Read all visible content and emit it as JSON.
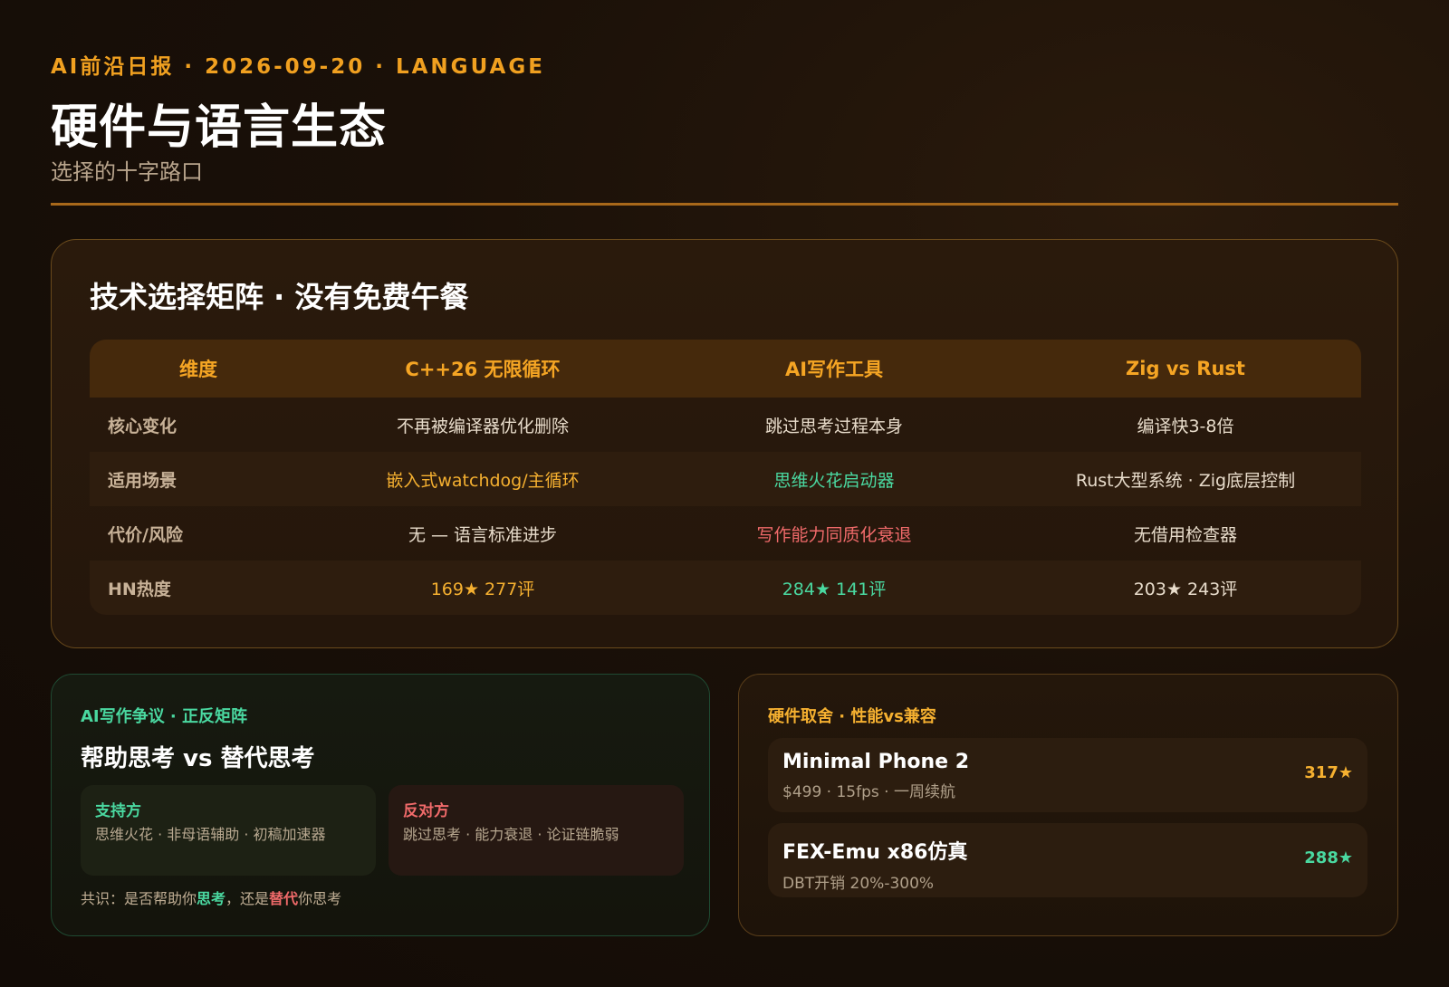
{
  "header": {
    "kicker": "AI前沿日报 · 2026-09-20 · LANGUAGE",
    "title": "硬件与语言生态",
    "subtitle": "选择的十字路口"
  },
  "matrix": {
    "title": "技术选择矩阵 · 没有免费午餐",
    "columns": [
      "维度",
      "C++26 无限循环",
      "AI写作工具",
      "Zig vs Rust"
    ],
    "rows": [
      {
        "label": "核心变化",
        "cells": [
          "不再被编译器优化删除",
          "跳过思考过程本身",
          "编译快3-8倍"
        ]
      },
      {
        "label": "适用场景",
        "cells": [
          "嵌入式watchdog/主循环",
          "思维火花启动器",
          "Rust大型系统 · Zig底层控制"
        ]
      },
      {
        "label": "代价/风险",
        "cells": [
          "无 — 语言标准进步",
          "写作能力同质化衰退",
          "无借用检查器"
        ]
      },
      {
        "label": "HN热度",
        "cells": [
          "169★ 277评",
          "284★ 141评",
          "203★ 243评"
        ]
      }
    ],
    "colors": {
      "amber": "#f5b030",
      "green": "#4ad8a0",
      "red": "#f06a6a"
    }
  },
  "ai_debate": {
    "kicker": "AI写作争议 · 正反矩阵",
    "heading": "帮助思考 vs 替代思考",
    "pro": {
      "label": "支持方",
      "text": "思维火花 · 非母语辅助 · 初稿加速器"
    },
    "con": {
      "label": "反对方",
      "text": "跳过思考 · 能力衰退 · 论证链脆弱"
    },
    "consensus": {
      "prefix": "共识：是否帮助你",
      "word1": "思考",
      "middle": "，还是",
      "word2": "替代",
      "suffix": "你思考"
    }
  },
  "hardware": {
    "kicker": "硬件取舍 · 性能vs兼容",
    "items": [
      {
        "name": "Minimal Phone 2",
        "meta": "$499 · 15fps · 一周续航",
        "stars": "317★"
      },
      {
        "name": "FEX-Emu x86仿真",
        "meta": "DBT开销 20%-300%",
        "stars": "288★"
      }
    ]
  }
}
